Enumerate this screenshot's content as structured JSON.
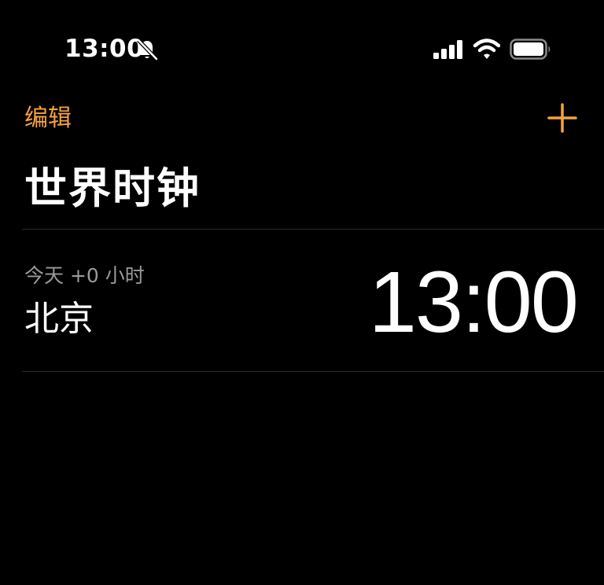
{
  "status_bar": {
    "time": "13:00",
    "icons": [
      "bell-slash-icon",
      "cellular-signal-icon",
      "wifi-icon",
      "battery-icon"
    ]
  },
  "nav": {
    "edit_label": "编辑",
    "add_icon": "plus-icon",
    "accent_color": "#f4a243"
  },
  "page": {
    "title": "世界时钟"
  },
  "clocks": [
    {
      "offset": "今天 +0 小时",
      "city": "北京",
      "time": "13:00"
    }
  ]
}
